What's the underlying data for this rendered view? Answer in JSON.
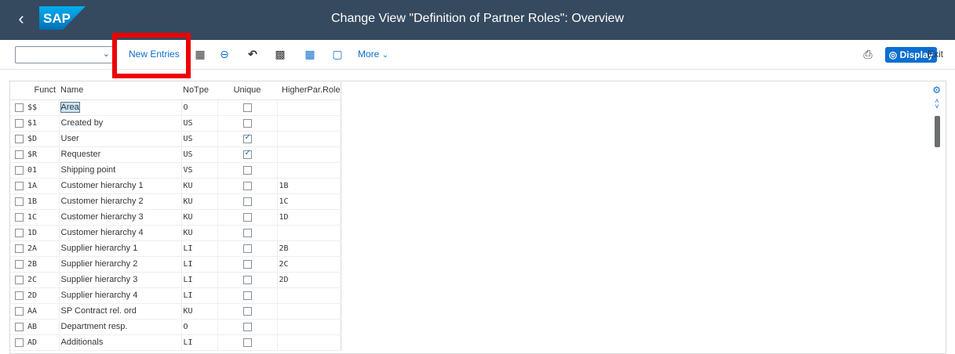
{
  "header": {
    "logo_text": "SAP",
    "title": "Change View \"Definition of Partner Roles\": Overview",
    "back_icon": "chevron-left-icon"
  },
  "toolbar": {
    "dropdown_value": "",
    "new_entries_label": "New Entries",
    "more_label": "More",
    "display_label": "Display",
    "exit_label": "Exit",
    "highlight_color": "#ee0000",
    "accent_color": "#0a6ed1"
  },
  "table": {
    "columns": {
      "funct": "Funct",
      "name": "Name",
      "notpe": "NoTpe",
      "unique": "Unique",
      "higher": "HigherPar.Role"
    },
    "rows": [
      {
        "funct": "$$",
        "name": "Area",
        "notpe": "O",
        "unique": false,
        "higher": ""
      },
      {
        "funct": "$1",
        "name": "Created by",
        "notpe": "US",
        "unique": false,
        "higher": ""
      },
      {
        "funct": "$D",
        "name": "User",
        "notpe": "US",
        "unique": true,
        "higher": ""
      },
      {
        "funct": "$R",
        "name": "Requester",
        "notpe": "US",
        "unique": true,
        "higher": ""
      },
      {
        "funct": "01",
        "name": "Shipping point",
        "notpe": "VS",
        "unique": false,
        "higher": ""
      },
      {
        "funct": "1A",
        "name": "Customer hierarchy 1",
        "notpe": "KU",
        "unique": false,
        "higher": "1B"
      },
      {
        "funct": "1B",
        "name": "Customer hierarchy 2",
        "notpe": "KU",
        "unique": false,
        "higher": "1C"
      },
      {
        "funct": "1C",
        "name": "Customer hierarchy 3",
        "notpe": "KU",
        "unique": false,
        "higher": "1D"
      },
      {
        "funct": "1D",
        "name": "Customer hierarchy 4",
        "notpe": "KU",
        "unique": false,
        "higher": ""
      },
      {
        "funct": "2A",
        "name": "Supplier hierarchy 1",
        "notpe": "LI",
        "unique": false,
        "higher": "2B"
      },
      {
        "funct": "2B",
        "name": "Supplier hierarchy 2",
        "notpe": "LI",
        "unique": false,
        "higher": "2C"
      },
      {
        "funct": "2C",
        "name": "Supplier hierarchy 3",
        "notpe": "LI",
        "unique": false,
        "higher": "2D"
      },
      {
        "funct": "2D",
        "name": "Supplier hierarchy 4",
        "notpe": "LI",
        "unique": false,
        "higher": ""
      },
      {
        "funct": "AA",
        "name": "SP Contract rel. ord",
        "notpe": "KU",
        "unique": false,
        "higher": ""
      },
      {
        "funct": "AB",
        "name": "Department resp.",
        "notpe": "O",
        "unique": false,
        "higher": ""
      },
      {
        "funct": "AD",
        "name": "Additionals",
        "notpe": "LI",
        "unique": false,
        "higher": ""
      }
    ]
  }
}
